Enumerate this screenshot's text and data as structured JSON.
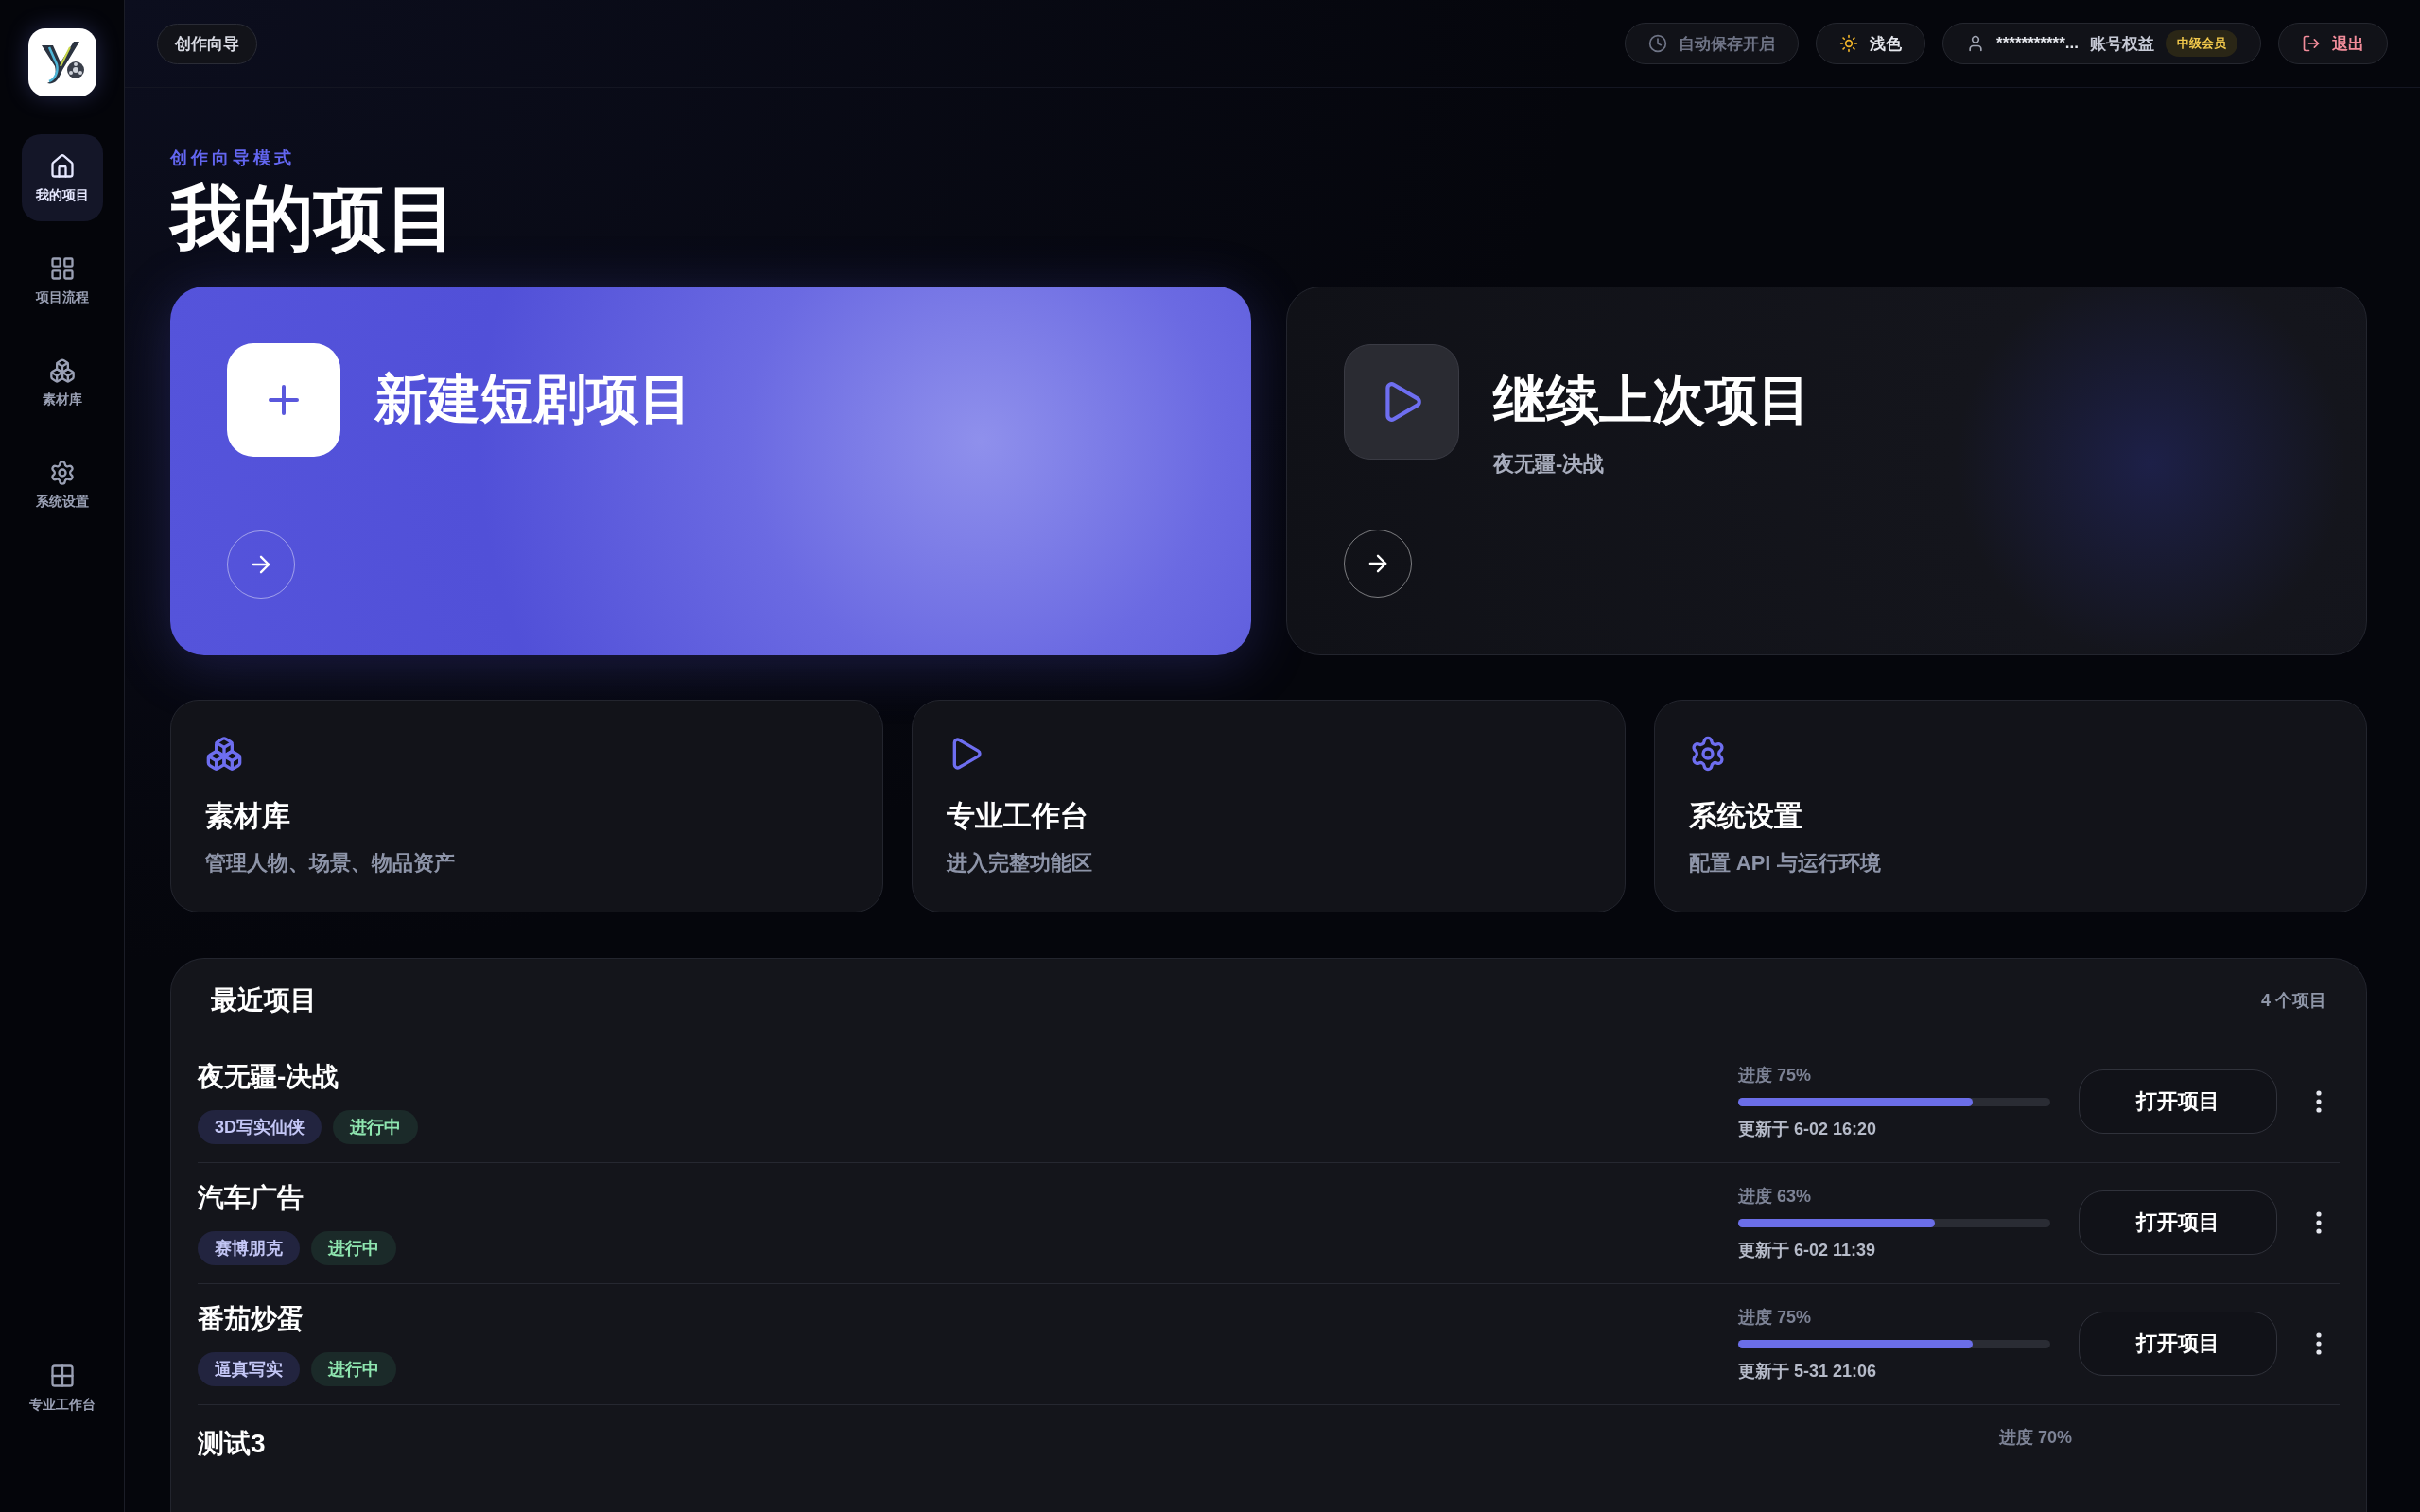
{
  "sidebar": {
    "items": [
      {
        "label": "我的项目",
        "selected": true
      },
      {
        "label": "项目流程",
        "selected": false
      },
      {
        "label": "素材库",
        "selected": false
      },
      {
        "label": "系统设置",
        "selected": false
      }
    ],
    "bottom_item": {
      "label": "专业工作台",
      "selected": false
    }
  },
  "topbar": {
    "mode_chip": "创作向导",
    "autosave": "自动保存开启",
    "theme": "浅色",
    "account": {
      "user": "***********...",
      "rights": "账号权益",
      "tier": "中级会员"
    },
    "logout": "退出"
  },
  "page": {
    "eyebrow": "创作向导模式",
    "title": "我的项目"
  },
  "hero_cards": [
    {
      "kind": "new",
      "title": "新建短剧项目"
    },
    {
      "kind": "continue",
      "title": "继续上次项目",
      "subtitle": "夜无疆-决战"
    }
  ],
  "feature_cards": [
    {
      "title": "素材库",
      "description": "管理人物、场景、物品资产"
    },
    {
      "title": "专业工作台",
      "description": "进入完整功能区"
    },
    {
      "title": "系统设置",
      "description": "配置 API 与运行环境"
    }
  ],
  "recent": {
    "title": "最近项目",
    "count": "4 个项目",
    "rows": [
      {
        "name": "夜无疆-决战",
        "tags": [
          {
            "label": "3D写实仙侠",
            "kind": "style"
          },
          {
            "label": "进行中",
            "kind": "status"
          }
        ],
        "progress": "进度 75%",
        "level": 0.75,
        "updated": "更新于 6-02 16:20",
        "action": "打开项目"
      },
      {
        "name": "汽车广告",
        "tags": [
          {
            "label": "赛博朋克",
            "kind": "style"
          },
          {
            "label": "进行中",
            "kind": "status"
          }
        ],
        "progress": "进度 63%",
        "level": 0.63,
        "updated": "更新于 6-02 11:39",
        "action": "打开项目"
      },
      {
        "name": "番茄炒蛋",
        "tags": [
          {
            "label": "逼真写实",
            "kind": "style"
          },
          {
            "label": "进行中",
            "kind": "status"
          }
        ],
        "progress": "进度 75%",
        "level": 0.75,
        "updated": "更新于 5-31 21:06",
        "action": "打开项目"
      },
      {
        "name": "测试3",
        "tags": [],
        "progress": "进度 70%"
      }
    ]
  }
}
